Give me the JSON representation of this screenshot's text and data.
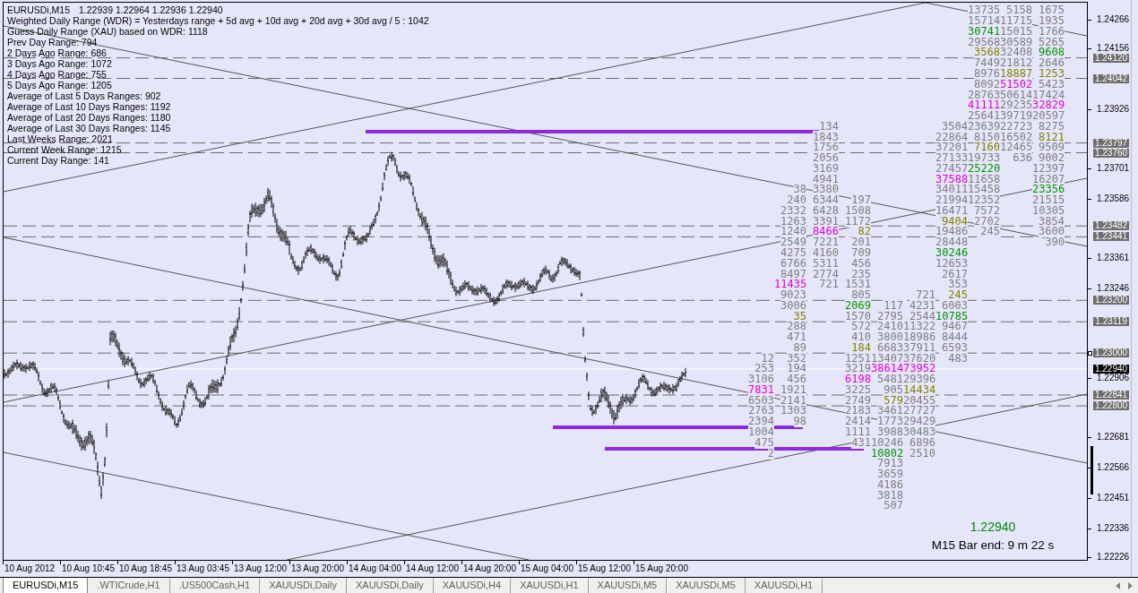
{
  "chart": {
    "header": {
      "symbol": "EURUSDi,M15",
      "prices": "1.22939 1.22964 1.22936 1.22940"
    },
    "range_stats": [
      "Weighted Daily Range (WDR) = Yesterdays range + 5d avg + 10d avg + 20d avg + 30d avg / 5 : 1042",
      "Guess Daily Range (XAU) based on WDR: 1118",
      "Prev Day Range: 794",
      "2 Days Ago Range: 686",
      "3 Days Ago Range: 1072",
      "4 Days Ago Range: 755",
      "5 Days Ago Range: 1205",
      "Average of Last 5 Days Ranges: 902",
      "Average of Last 10 Days Ranges: 1192",
      "Average of Last 20 Days Ranges: 1180",
      "Average of Last 30 Days Ranges: 1145",
      "Last Weeks Range: 2021",
      "Current Week Range: 1215",
      "Current Day Range: 141"
    ],
    "volume_grid": {
      "rows": [
        [
          null,
          null,
          null,
          null,
          null,
          null,
          null,
          {
            "text": "13735",
            "color": "#7e7e7e"
          },
          {
            "text": "5158",
            "color": "#7e7e7e"
          },
          {
            "text": "1675",
            "color": "#7e7e7e"
          }
        ],
        [
          null,
          null,
          null,
          null,
          null,
          null,
          null,
          {
            "text": "15714",
            "color": "#7e7e7e"
          },
          {
            "text": "11715",
            "color": "#7e7e7e"
          },
          {
            "text": "1935",
            "color": "#7e7e7e"
          }
        ],
        [
          null,
          null,
          null,
          null,
          null,
          null,
          null,
          {
            "text": "30741",
            "color": "#009400"
          },
          {
            "text": "15015",
            "color": "#7e7e7e"
          },
          {
            "text": "1766",
            "color": "#7e7e7e"
          }
        ],
        [
          null,
          null,
          null,
          null,
          null,
          null,
          null,
          {
            "text": "29568",
            "color": "#7e7e7e"
          },
          {
            "text": "30589",
            "color": "#7e7e7e"
          },
          {
            "text": "5265",
            "color": "#7e7e7e"
          }
        ],
        [
          null,
          null,
          null,
          null,
          null,
          null,
          null,
          {
            "text": "3568",
            "color": "#828200"
          },
          {
            "text": "32408",
            "color": "#7e7e7e"
          },
          {
            "text": "9608",
            "color": "#009400"
          }
        ],
        [
          null,
          null,
          null,
          null,
          null,
          null,
          null,
          {
            "text": "7449",
            "color": "#7e7e7e"
          },
          {
            "text": "21812",
            "color": "#7e7e7e"
          },
          {
            "text": "2646",
            "color": "#7e7e7e"
          }
        ],
        [
          null,
          null,
          null,
          null,
          null,
          null,
          null,
          {
            "text": "8976",
            "color": "#7e7e7e"
          },
          {
            "text": "18887",
            "color": "#828200"
          },
          {
            "text": "1253",
            "color": "#828200"
          }
        ],
        [
          null,
          null,
          null,
          null,
          null,
          null,
          null,
          {
            "text": "8092",
            "color": "#7e7e7e"
          },
          {
            "text": "51502",
            "color": "#dc00dc"
          },
          {
            "text": "5423",
            "color": "#7e7e7e"
          }
        ],
        [
          null,
          null,
          null,
          null,
          null,
          null,
          null,
          {
            "text": "28763",
            "color": "#7e7e7e"
          },
          {
            "text": "50614",
            "color": "#7e7e7e"
          },
          {
            "text": "17424",
            "color": "#7e7e7e"
          }
        ],
        [
          null,
          null,
          null,
          null,
          null,
          null,
          null,
          {
            "text": "41111",
            "color": "#dc00dc"
          },
          {
            "text": "29235",
            "color": "#7e7e7e"
          },
          {
            "text": "32829",
            "color": "#dc00dc"
          }
        ],
        [
          null,
          null,
          null,
          null,
          null,
          null,
          null,
          {
            "text": "25641",
            "color": "#7e7e7e"
          },
          {
            "text": "39719",
            "color": "#7e7e7e"
          },
          {
            "text": "20597",
            "color": "#7e7e7e"
          }
        ],
        [
          null,
          null,
          {
            "text": "134",
            "color": "#7e7e7e"
          },
          null,
          null,
          null,
          {
            "text": "3504",
            "color": "#7e7e7e"
          },
          {
            "text": "23639",
            "color": "#7e7e7e"
          },
          {
            "text": "22723",
            "color": "#7e7e7e"
          },
          {
            "text": "8275",
            "color": "#7e7e7e"
          }
        ],
        [
          null,
          null,
          {
            "text": "1843",
            "color": "#7e7e7e"
          },
          null,
          null,
          null,
          {
            "text": "22864",
            "color": "#7e7e7e"
          },
          {
            "text": "8150",
            "color": "#7e7e7e"
          },
          {
            "text": "16502",
            "color": "#7e7e7e"
          },
          {
            "text": "8121",
            "color": "#828200"
          }
        ],
        [
          null,
          null,
          {
            "text": "1756",
            "color": "#7e7e7e"
          },
          null,
          null,
          null,
          {
            "text": "37201",
            "color": "#7e7e7e"
          },
          {
            "text": "7160",
            "color": "#828200"
          },
          {
            "text": "12465",
            "color": "#7e7e7e"
          },
          {
            "text": "9509",
            "color": "#7e7e7e"
          }
        ],
        [
          null,
          null,
          {
            "text": "2056",
            "color": "#7e7e7e"
          },
          null,
          null,
          null,
          {
            "text": "27133",
            "color": "#7e7e7e"
          },
          {
            "text": "19733",
            "color": "#7e7e7e"
          },
          {
            "text": "636",
            "color": "#7e7e7e"
          },
          {
            "text": "9002",
            "color": "#7e7e7e"
          }
        ],
        [
          null,
          null,
          {
            "text": "3169",
            "color": "#7e7e7e"
          },
          null,
          null,
          null,
          {
            "text": "27457",
            "color": "#7e7e7e"
          },
          {
            "text": "25220",
            "color": "#009400"
          },
          null,
          {
            "text": "12397",
            "color": "#7e7e7e"
          }
        ],
        [
          null,
          null,
          {
            "text": "4941",
            "color": "#7e7e7e"
          },
          null,
          null,
          null,
          {
            "text": "37588",
            "color": "#dc00dc"
          },
          {
            "text": "11658",
            "color": "#7e7e7e"
          },
          null,
          {
            "text": "16207",
            "color": "#7e7e7e"
          }
        ],
        [
          null,
          {
            "text": "38",
            "color": "#7e7e7e"
          },
          {
            "text": "3380",
            "color": "#7e7e7e"
          },
          null,
          null,
          null,
          {
            "text": "34011",
            "color": "#7e7e7e"
          },
          {
            "text": "15458",
            "color": "#7e7e7e"
          },
          null,
          {
            "text": "23356",
            "color": "#009400"
          }
        ],
        [
          null,
          {
            "text": "240",
            "color": "#7e7e7e"
          },
          {
            "text": "6344",
            "color": "#7e7e7e"
          },
          {
            "text": "197",
            "color": "#7e7e7e"
          },
          null,
          null,
          {
            "text": "21994",
            "color": "#7e7e7e"
          },
          {
            "text": "12352",
            "color": "#7e7e7e"
          },
          null,
          {
            "text": "21515",
            "color": "#7e7e7e"
          }
        ],
        [
          null,
          {
            "text": "2332",
            "color": "#7e7e7e"
          },
          {
            "text": "6428",
            "color": "#7e7e7e"
          },
          {
            "text": "1508",
            "color": "#7e7e7e"
          },
          null,
          null,
          {
            "text": "16471",
            "color": "#7e7e7e"
          },
          {
            "text": "7572",
            "color": "#7e7e7e"
          },
          null,
          {
            "text": "10305",
            "color": "#7e7e7e"
          }
        ],
        [
          null,
          {
            "text": "1263",
            "color": "#7e7e7e"
          },
          {
            "text": "3391",
            "color": "#7e7e7e"
          },
          {
            "text": "1172",
            "color": "#7e7e7e"
          },
          null,
          null,
          {
            "text": "9404",
            "color": "#828200"
          },
          {
            "text": "2702",
            "color": "#7e7e7e"
          },
          null,
          {
            "text": "3854",
            "color": "#7e7e7e"
          }
        ],
        [
          null,
          {
            "text": "1240",
            "color": "#7e7e7e"
          },
          {
            "text": "8466",
            "color": "#dc00dc"
          },
          {
            "text": "82",
            "color": "#828200"
          },
          null,
          null,
          {
            "text": "19486",
            "color": "#7e7e7e"
          },
          {
            "text": "245",
            "color": "#7e7e7e"
          },
          null,
          {
            "text": "3600",
            "color": "#7e7e7e"
          }
        ],
        [
          null,
          {
            "text": "2549",
            "color": "#7e7e7e"
          },
          {
            "text": "7221",
            "color": "#7e7e7e"
          },
          {
            "text": "201",
            "color": "#7e7e7e"
          },
          null,
          null,
          {
            "text": "28448",
            "color": "#7e7e7e"
          },
          null,
          null,
          {
            "text": "390",
            "color": "#7e7e7e"
          }
        ],
        [
          null,
          {
            "text": "4275",
            "color": "#7e7e7e"
          },
          {
            "text": "4160",
            "color": "#7e7e7e"
          },
          {
            "text": "709",
            "color": "#7e7e7e"
          },
          null,
          null,
          {
            "text": "30246",
            "color": "#009400"
          }
        ],
        [
          null,
          {
            "text": "6766",
            "color": "#7e7e7e"
          },
          {
            "text": "5311",
            "color": "#7e7e7e"
          },
          {
            "text": "456",
            "color": "#7e7e7e"
          },
          null,
          null,
          {
            "text": "12653",
            "color": "#7e7e7e"
          }
        ],
        [
          null,
          {
            "text": "8497",
            "color": "#7e7e7e"
          },
          {
            "text": "2774",
            "color": "#7e7e7e"
          },
          {
            "text": "235",
            "color": "#7e7e7e"
          },
          null,
          null,
          {
            "text": "2617",
            "color": "#7e7e7e"
          }
        ],
        [
          null,
          {
            "text": "11435",
            "color": "#dc00dc"
          },
          {
            "text": "721",
            "color": "#7e7e7e"
          },
          {
            "text": "1531",
            "color": "#7e7e7e"
          },
          null,
          null,
          {
            "text": "353",
            "color": "#7e7e7e"
          }
        ],
        [
          null,
          {
            "text": "9023",
            "color": "#7e7e7e"
          },
          null,
          {
            "text": "805",
            "color": "#7e7e7e"
          },
          null,
          {
            "text": "721",
            "color": "#7e7e7e"
          },
          {
            "text": "245",
            "color": "#828200"
          }
        ],
        [
          null,
          {
            "text": "3006",
            "color": "#7e7e7e"
          },
          null,
          {
            "text": "2069",
            "color": "#009400"
          },
          {
            "text": "117",
            "color": "#7e7e7e"
          },
          {
            "text": "4231",
            "color": "#7e7e7e"
          },
          {
            "text": "6003",
            "color": "#7e7e7e"
          }
        ],
        [
          null,
          {
            "text": "35",
            "color": "#828200"
          },
          null,
          {
            "text": "1570",
            "color": "#7e7e7e"
          },
          {
            "text": "2795",
            "color": "#7e7e7e"
          },
          {
            "text": "2544",
            "color": "#7e7e7e"
          },
          {
            "text": "10785",
            "color": "#009400"
          }
        ],
        [
          null,
          {
            "text": "288",
            "color": "#7e7e7e"
          },
          null,
          {
            "text": "572",
            "color": "#7e7e7e"
          },
          {
            "text": "2410",
            "color": "#7e7e7e"
          },
          {
            "text": "11322",
            "color": "#7e7e7e"
          },
          {
            "text": "9467",
            "color": "#7e7e7e"
          }
        ],
        [
          null,
          {
            "text": "471",
            "color": "#7e7e7e"
          },
          null,
          {
            "text": "410",
            "color": "#7e7e7e"
          },
          {
            "text": "3800",
            "color": "#7e7e7e"
          },
          {
            "text": "18986",
            "color": "#7e7e7e"
          },
          {
            "text": "8444",
            "color": "#7e7e7e"
          }
        ],
        [
          null,
          {
            "text": "89",
            "color": "#7e7e7e"
          },
          null,
          {
            "text": "184",
            "color": "#828200"
          },
          {
            "text": "6683",
            "color": "#7e7e7e"
          },
          {
            "text": "37911",
            "color": "#7e7e7e"
          },
          {
            "text": "6593",
            "color": "#7e7e7e"
          }
        ],
        [
          {
            "text": "12",
            "color": "#7e7e7e"
          },
          {
            "text": "352",
            "color": "#7e7e7e"
          },
          null,
          {
            "text": "1251",
            "color": "#7e7e7e"
          },
          {
            "text": "13407",
            "color": "#7e7e7e"
          },
          {
            "text": "37620",
            "color": "#7e7e7e"
          },
          {
            "text": "483",
            "color": "#7e7e7e"
          }
        ],
        [
          {
            "text": "253",
            "color": "#7e7e7e"
          },
          {
            "text": "194",
            "color": "#7e7e7e"
          },
          null,
          {
            "text": "3219",
            "color": "#7e7e7e"
          },
          {
            "text": "38614",
            "color": "#dc00dc"
          },
          {
            "text": "73952",
            "color": "#dc00dc"
          }
        ],
        [
          {
            "text": "3106",
            "color": "#7e7e7e"
          },
          {
            "text": "456",
            "color": "#7e7e7e"
          },
          null,
          {
            "text": "6198",
            "color": "#dc00dc"
          },
          {
            "text": "5481",
            "color": "#7e7e7e"
          },
          {
            "text": "29396",
            "color": "#7e7e7e"
          }
        ],
        [
          {
            "text": "7831",
            "color": "#dc00dc"
          },
          {
            "text": "1921",
            "color": "#7e7e7e"
          },
          null,
          {
            "text": "3225",
            "color": "#7e7e7e"
          },
          {
            "text": "905",
            "color": "#7e7e7e"
          },
          {
            "text": "14434",
            "color": "#828200"
          }
        ],
        [
          {
            "text": "6503",
            "color": "#7e7e7e"
          },
          {
            "text": "2141",
            "color": "#7e7e7e"
          },
          null,
          {
            "text": "2749",
            "color": "#7e7e7e"
          },
          {
            "text": "579",
            "color": "#828200"
          },
          {
            "text": "20455",
            "color": "#7e7e7e"
          }
        ],
        [
          {
            "text": "2763",
            "color": "#7e7e7e"
          },
          {
            "text": "1303",
            "color": "#7e7e7e"
          },
          null,
          {
            "text": "2183",
            "color": "#7e7e7e"
          },
          {
            "text": "3461",
            "color": "#7e7e7e"
          },
          {
            "text": "27727",
            "color": "#7e7e7e"
          }
        ],
        [
          {
            "text": "2394",
            "color": "#7e7e7e"
          },
          {
            "text": "98",
            "color": "#7e7e7e"
          },
          null,
          {
            "text": "2414",
            "color": "#7e7e7e"
          },
          {
            "text": "1773",
            "color": "#7e7e7e"
          },
          {
            "text": "29429",
            "color": "#7e7e7e"
          }
        ],
        [
          {
            "text": "1004",
            "color": "#7e7e7e"
          },
          null,
          null,
          {
            "text": "1111",
            "color": "#7e7e7e"
          },
          {
            "text": "3988",
            "color": "#7e7e7e"
          },
          {
            "text": "30483",
            "color": "#7e7e7e"
          }
        ],
        [
          {
            "text": "475",
            "color": "#7e7e7e"
          },
          null,
          null,
          {
            "text": "431",
            "color": "#7e7e7e"
          },
          {
            "text": "10246",
            "color": "#7e7e7e"
          },
          {
            "text": "6896",
            "color": "#7e7e7e"
          }
        ],
        [
          {
            "text": "2",
            "color": "#7e7e7e"
          },
          null,
          null,
          null,
          {
            "text": "10802",
            "color": "#009400"
          },
          {
            "text": "2510",
            "color": "#7e7e7e"
          }
        ],
        [
          null,
          null,
          null,
          null,
          {
            "text": "7913",
            "color": "#7e7e7e"
          }
        ],
        [
          null,
          null,
          null,
          null,
          {
            "text": "3659",
            "color": "#7e7e7e"
          }
        ],
        [
          null,
          null,
          null,
          null,
          {
            "text": "4186",
            "color": "#7e7e7e"
          }
        ],
        [
          null,
          null,
          null,
          null,
          {
            "text": "3818",
            "color": "#7e7e7e"
          }
        ],
        [
          null,
          null,
          null,
          null,
          {
            "text": "507",
            "color": "#7e7e7e"
          }
        ]
      ]
    },
    "live_price": "1.22940",
    "bar_timer": "M15 Bar end: 9 m 22 s"
  },
  "price_axis": {
    "ticks": [
      "1.24266",
      "1.24156",
      "1.23926",
      "1.23701",
      "1.23586",
      "1.23361",
      "1.23246",
      "1.22906",
      "1.22681",
      "1.22566",
      "1.22451",
      "1.22336",
      "1.22226"
    ],
    "level_labels": [
      "1.24120",
      "1.24042",
      "1.23797",
      "1.23760",
      "1.23482",
      "1.23441",
      "1.23200",
      "1.23119",
      "1.23000",
      "1.22841",
      "1.22800"
    ],
    "current_price": "1.22940"
  },
  "time_axis": {
    "labels": [
      "10 Aug 2012",
      "10 Aug 10:45",
      "10 Aug 18:45",
      "13 Aug 03:45",
      "13 Aug 12:00",
      "13 Aug 20:00",
      "14 Aug 04:00",
      "14 Aug 12:00",
      "14 Aug 20:00",
      "15 Aug 04:00",
      "15 Aug 12:00",
      "15 Aug 20:00"
    ]
  },
  "tabs": [
    {
      "label": "EURUSDi,M15",
      "selected": true
    },
    {
      "label": ".WTICrude,H1",
      "selected": false
    },
    {
      "label": ".US500Cash,H1",
      "selected": false
    },
    {
      "label": "XAUUSDi,Daily",
      "selected": false
    },
    {
      "label": "XAUUSDi,Daily",
      "selected": false
    },
    {
      "label": "XAUUSDi,H4",
      "selected": false
    },
    {
      "label": "XAUUSDi,H1",
      "selected": false
    },
    {
      "label": "XAUUSDi,M5",
      "selected": false
    },
    {
      "label": "XAUUSDi,M5",
      "selected": false
    },
    {
      "label": "XAUUSDi,H1",
      "selected": false
    }
  ]
}
